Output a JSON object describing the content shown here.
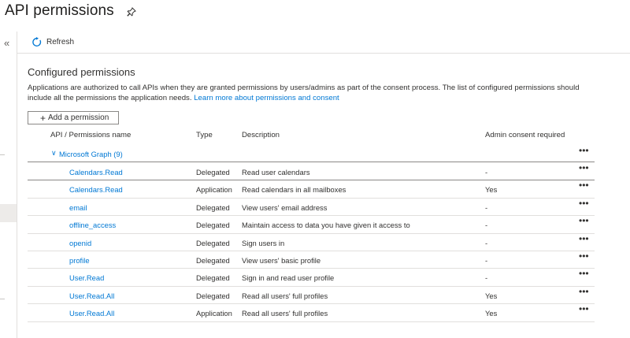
{
  "page": {
    "title": "API permissions"
  },
  "icons": {
    "pin": "pin-icon",
    "collapse": "double-chevron-left-icon",
    "refresh": "refresh-icon",
    "add": "plus-icon",
    "more": "more-horizontal-icon",
    "expand": "chevron-down-icon"
  },
  "colors": {
    "link": "#0078d4",
    "text": "#323130",
    "border": "#e1dfdd"
  },
  "toolbar": {
    "refresh_label": "Refresh",
    "collapse_glyph": "«"
  },
  "section": {
    "title": "Configured permissions",
    "intro": "Applications are authorized to call APIs when they are granted permissions by users/admins as part of the consent process. The list of configured permissions should include all the permissions the application needs.",
    "learn_more": "Learn more about permissions and consent"
  },
  "add_button": {
    "label": "Add a permission",
    "glyph": "+"
  },
  "table": {
    "headers": {
      "name": "API / Permissions name",
      "type": "Type",
      "description": "Description",
      "consent": "Admin consent required"
    },
    "more_glyph": "•••",
    "group": {
      "label": "Microsoft Graph (9)",
      "chevron": "∨"
    },
    "rows": [
      {
        "name": "Calendars.Read",
        "type": "Delegated",
        "description": "Read user calendars",
        "consent": "-"
      },
      {
        "name": "Calendars.Read",
        "type": "Application",
        "description": "Read calendars in all mailboxes",
        "consent": "Yes"
      },
      {
        "name": "email",
        "type": "Delegated",
        "description": "View users' email address",
        "consent": "-"
      },
      {
        "name": "offline_access",
        "type": "Delegated",
        "description": "Maintain access to data you have given it access to",
        "consent": "-"
      },
      {
        "name": "openid",
        "type": "Delegated",
        "description": "Sign users in",
        "consent": "-"
      },
      {
        "name": "profile",
        "type": "Delegated",
        "description": "View users' basic profile",
        "consent": "-"
      },
      {
        "name": "User.Read",
        "type": "Delegated",
        "description": "Sign in and read user profile",
        "consent": "-"
      },
      {
        "name": "User.Read.All",
        "type": "Delegated",
        "description": "Read all users' full profiles",
        "consent": "Yes"
      },
      {
        "name": "User.Read.All",
        "type": "Application",
        "description": "Read all users' full profiles",
        "consent": "Yes"
      }
    ]
  }
}
